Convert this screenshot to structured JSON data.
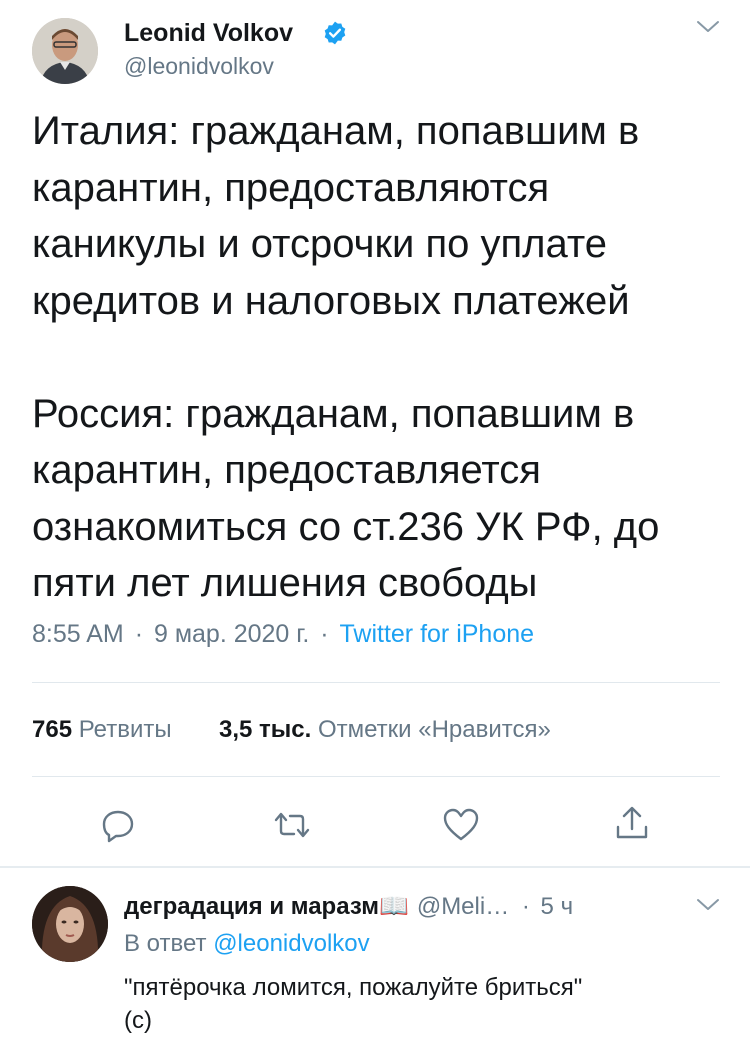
{
  "tweet": {
    "author_name": "Leonid Volkov",
    "author_handle": "@leonidvolkov",
    "text": "Италия: гражданам, попавшим в\nкарантин, предоставляются\nканикулы и отсрочки по уплате\nкредитов и налоговых платежей\n\nРоссия: гражданам, попавшим в\nкарантин, предоставляется\nознакомиться со ст.236 УК РФ, до\nпяти лет лишения свободы",
    "time": "8:55 AM",
    "date": "9 мар. 2020 г.",
    "source": "Twitter for iPhone",
    "separator": "·",
    "retweets_count": "765",
    "retweets_label": "Ретвиты",
    "likes_count": "3,5 тыс.",
    "likes_label": "Отметки «Нравится»"
  },
  "actions": [
    "reply-icon",
    "retweet-icon",
    "like-icon",
    "share-icon"
  ],
  "reply": {
    "author_name": "деградация и маразм📖",
    "author_handle": "@Meli…",
    "time_sep": "·",
    "time": "5 ч",
    "reply_to_label": "В ответ",
    "reply_to_handle": "@leonidvolkov",
    "text": "\"пятёрочка ломится, пожалуйте бриться\"\n(с)"
  },
  "colors": {
    "accent": "#1da1f2",
    "secondary_text": "#657786",
    "divider": "#e1e8ed"
  }
}
